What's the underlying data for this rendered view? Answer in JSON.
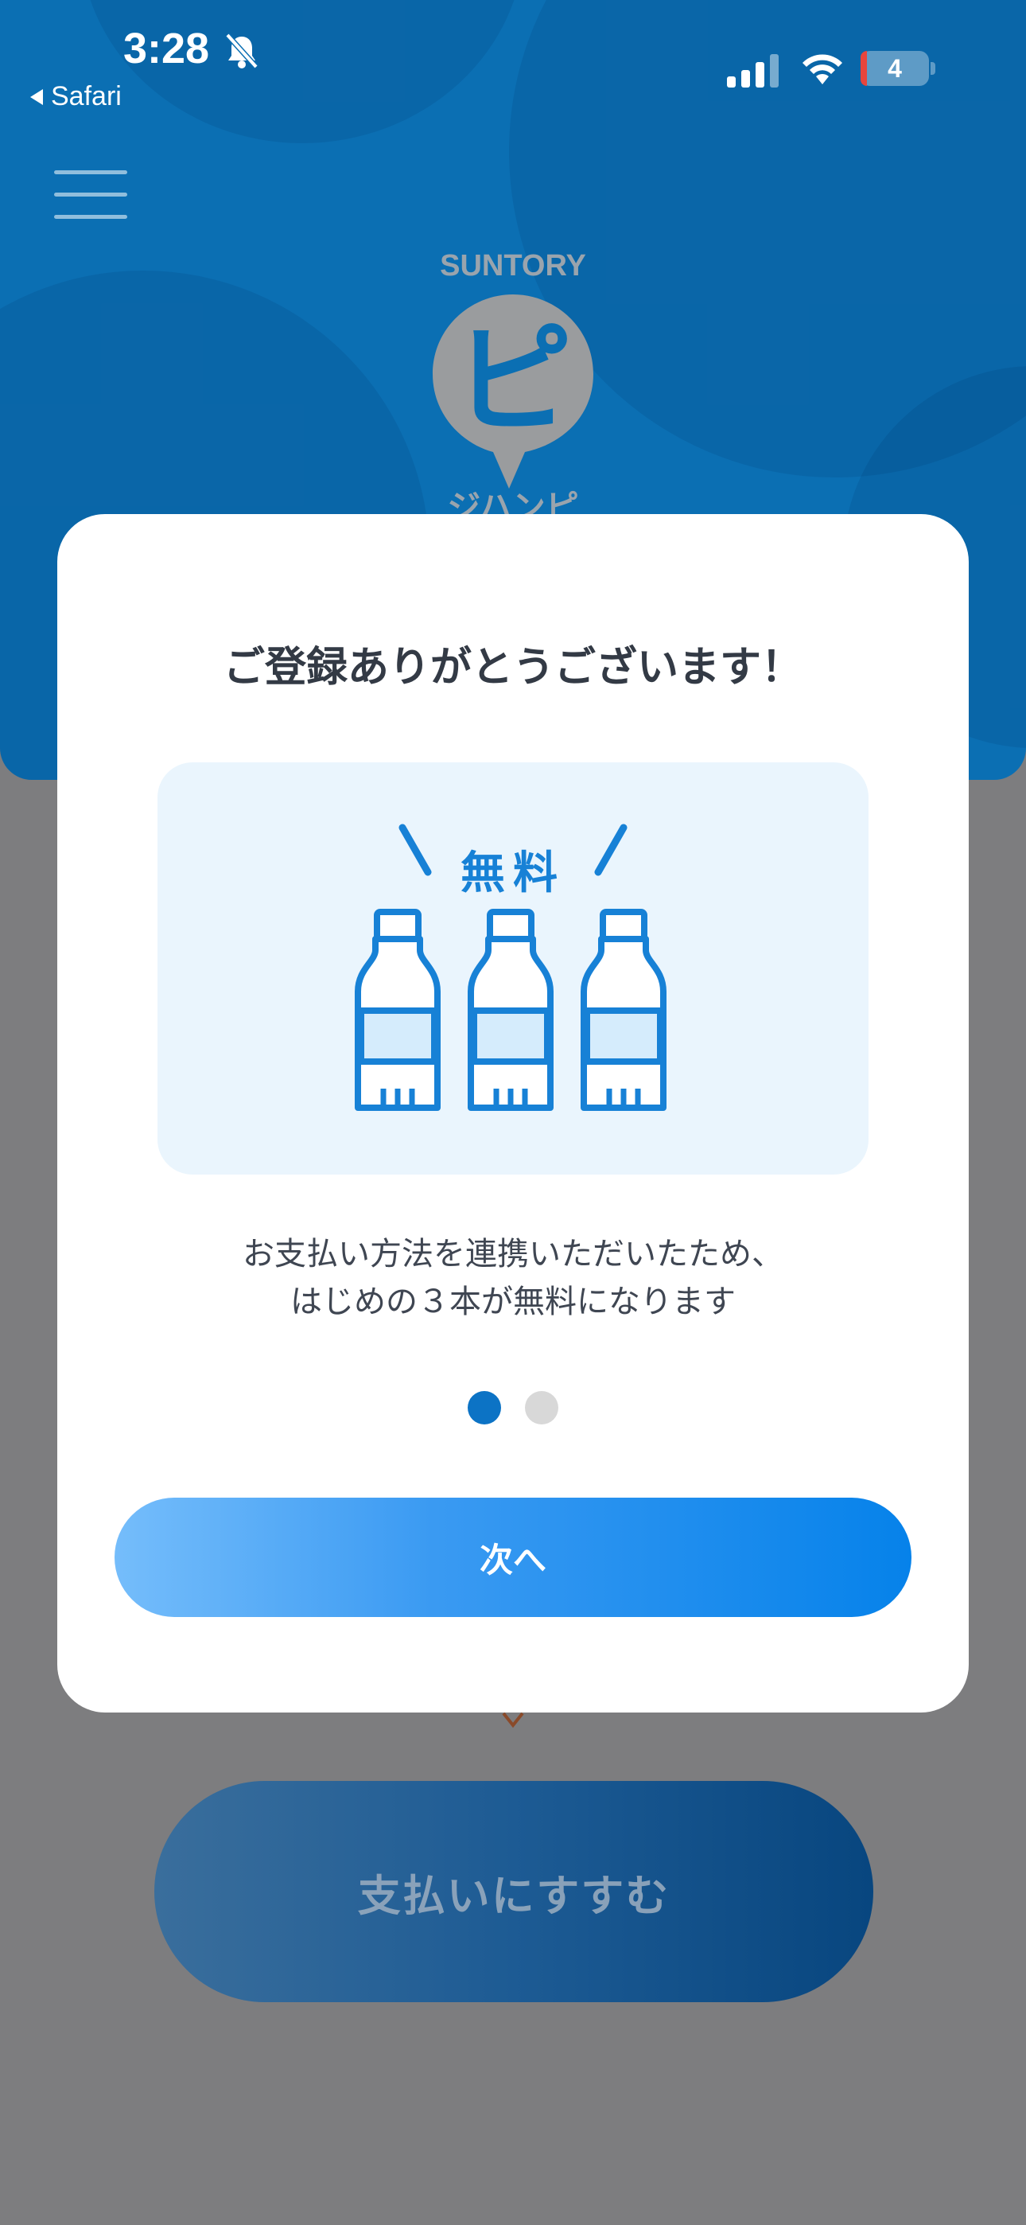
{
  "status_bar": {
    "time": "3:28",
    "back_app": "Safari",
    "battery": "4"
  },
  "logo": {
    "brand": "SUNTORY",
    "mark": "ピ",
    "name": "ジハンピ"
  },
  "modal": {
    "title": "ご登録ありがとうございます！",
    "badge": "無料",
    "description_line1": "お支払い方法を連携いただいたため、",
    "description_line2": "はじめの３本が無料になります",
    "page_current": 1,
    "page_total": 2,
    "next_label": "次へ"
  },
  "background": {
    "pay_button_label": "支払いにすすむ"
  },
  "colors": {
    "header_blue": "#0b6fb3",
    "accent_blue": "#1781d6",
    "dot_active": "#0c73c5",
    "title_text": "#333a45"
  }
}
